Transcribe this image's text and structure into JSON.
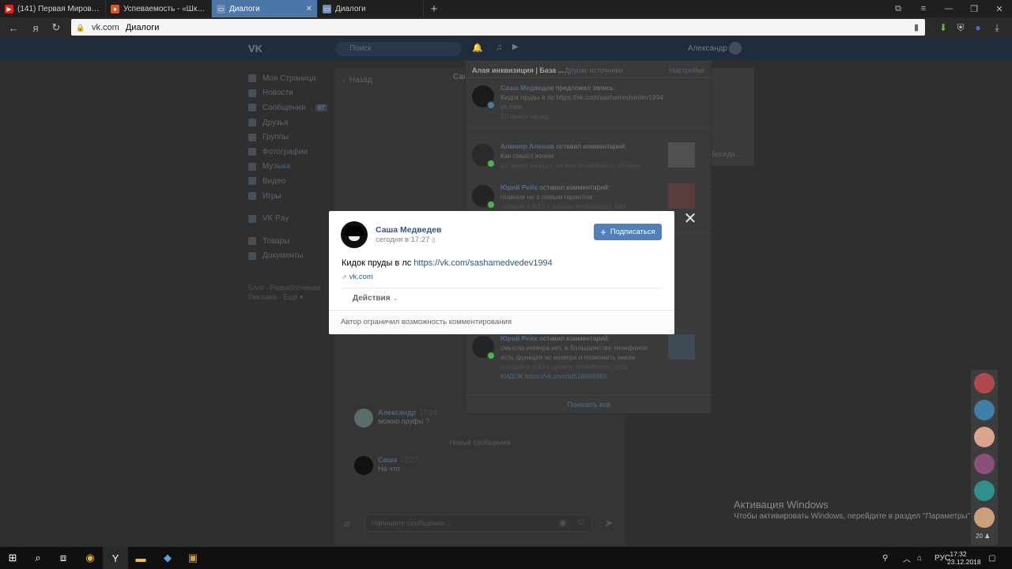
{
  "browser": {
    "tabs": [
      {
        "title": "(141) Первая Мировая. Бо",
        "icon_color": "#e62117",
        "icon": "youtube-icon"
      },
      {
        "title": "Успеваемость - «Школьн",
        "icon_color": "#d35a2a",
        "icon": "school-icon"
      },
      {
        "title": "Диалоги",
        "icon_color": "#6f8fb8",
        "icon": "vk-icon",
        "active": true,
        "close": "✕"
      },
      {
        "title": "Диалоги",
        "icon_color": "#6f8fb8",
        "icon": "vk-icon"
      }
    ],
    "new_tab": "+",
    "address": {
      "domain": "vk.com",
      "page_title": "Диалоги"
    }
  },
  "vk": {
    "logo": "VK",
    "search_placeholder": "Поиск",
    "user_name": "Александр",
    "left_menu": [
      {
        "label": "Моя Страница"
      },
      {
        "label": "Новости"
      },
      {
        "label": "Сообщения",
        "badge": "67"
      },
      {
        "label": "Друзья"
      },
      {
        "label": "Группы"
      },
      {
        "label": "Фотографии"
      },
      {
        "label": "Музыка"
      },
      {
        "label": "Видео"
      },
      {
        "label": "Игры"
      },
      {
        "label": "VK Pay"
      },
      {
        "label": "Товары"
      },
      {
        "label": "Документы"
      }
    ],
    "footer_lines": [
      "Блог · Разработчикам",
      "Реклама · Ещё ▾"
    ],
    "im": {
      "back": "Назад",
      "title": "Саш",
      "messages": [
        {
          "author": "Александр",
          "time": "17:24",
          "text": "можно пруфы ?"
        },
        {
          "author": "Саша",
          "time": "17:27",
          "text": "На что"
        }
      ],
      "new_messages": "Новые сообщения",
      "composer_placeholder": "Напишите сообщение..."
    },
    "right_card_link": "беседа ..."
  },
  "notifications": {
    "tab_active": "Алая инквизиция | База ...",
    "tab_other": "Другие источники",
    "settings": "Настройки",
    "items": [
      {
        "author": "Саша Медведев",
        "action": "предложил запись:",
        "line2": "Кидок пруды в лс https://vk.com/sashamedvedev1994",
        "line3": "vk.com",
        "line4": "10 минут назад",
        "badge_color": "#4a76a8"
      },
      {
        "author": "Алмамр Аленов",
        "action": "оставил комментарий:",
        "line2": "Как смысл жизни",
        "line3": "",
        "line4": "12 минут назад к записи #redalliance_memes",
        "badge_color": "#4bb34b"
      },
      {
        "author": "Юрий Рейх",
        "action": "оставил комментарий:",
        "line2": "главное не с левым гарантом",
        "line3": "",
        "line4": "сегодня в 9:18 к записи #redalliance_info",
        "badge_color": "#4bb34b"
      },
      {
        "author": "Юрий Рейх",
        "action": "оставил комментарий:",
        "line2": "смысла номера нет, в большинстве телефонов",
        "line3": "есть функция чс номера и позвонить никак",
        "line4": "сегодня в 9:14 к записи #redalliance_kido",
        "badge_color": "#4bb34b"
      }
    ],
    "extra_line": "КИДОК https://vk.com/id518665963",
    "show_all": "Показать все"
  },
  "modal": {
    "author": "Саша Медведев",
    "time": "сегодня в 17:27",
    "subscribe_label": "Подписаться",
    "text_prefix": "Кидок пруды в лс ",
    "text_link": "https://vk.com/sashamedvedev1994",
    "link_domain": "vk.com",
    "actions_label": "Действия",
    "comments_disabled": "Автор ограничил возможность комментирования",
    "close": "✕"
  },
  "watermark": {
    "title": "Активация Windows",
    "subtitle": "Чтобы активировать Windows, перейдите в раздел \"Параметры\"."
  },
  "dock": {
    "avatar_colors": [
      "#b04a4a",
      "#3f7fa8",
      "#d9a58f",
      "#8a4f7a",
      "#2f8f8a",
      "#c9a07a"
    ],
    "count": "20 ♟"
  },
  "taskbar": {
    "lang": "РУС",
    "time": "17:32",
    "date": "23.12.2018"
  },
  "colors": {
    "vk_blue": "#5181b8",
    "link": "#2a5885"
  }
}
